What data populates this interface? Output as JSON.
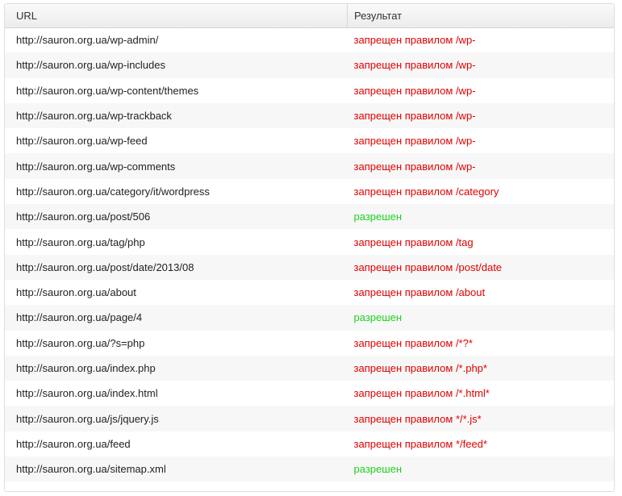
{
  "table": {
    "headers": {
      "url": "URL",
      "result": "Результат"
    },
    "colors": {
      "denied": "#e00000",
      "allowed": "#1ed21e"
    },
    "rows": [
      {
        "url": "http://sauron.org.ua/wp-admin/",
        "result": "запрещен правилом /wp-",
        "status": "denied"
      },
      {
        "url": "http://sauron.org.ua/wp-includes",
        "result": "запрещен правилом /wp-",
        "status": "denied"
      },
      {
        "url": "http://sauron.org.ua/wp-content/themes",
        "result": "запрещен правилом /wp-",
        "status": "denied"
      },
      {
        "url": "http://sauron.org.ua/wp-trackback",
        "result": "запрещен правилом /wp-",
        "status": "denied"
      },
      {
        "url": "http://sauron.org.ua/wp-feed",
        "result": "запрещен правилом /wp-",
        "status": "denied"
      },
      {
        "url": "http://sauron.org.ua/wp-comments",
        "result": "запрещен правилом /wp-",
        "status": "denied"
      },
      {
        "url": "http://sauron.org.ua/category/it/wordpress",
        "result": "запрещен правилом /category",
        "status": "denied"
      },
      {
        "url": "http://sauron.org.ua/post/506",
        "result": "разрешен",
        "status": "allowed"
      },
      {
        "url": "http://sauron.org.ua/tag/php",
        "result": "запрещен правилом /tag",
        "status": "denied"
      },
      {
        "url": "http://sauron.org.ua/post/date/2013/08",
        "result": "запрещен правилом /post/date",
        "status": "denied"
      },
      {
        "url": "http://sauron.org.ua/about",
        "result": "запрещен правилом /about",
        "status": "denied"
      },
      {
        "url": "http://sauron.org.ua/page/4",
        "result": "разрешен",
        "status": "allowed"
      },
      {
        "url": "http://sauron.org.ua/?s=php",
        "result": "запрещен правилом /*?*",
        "status": "denied"
      },
      {
        "url": "http://sauron.org.ua/index.php",
        "result": "запрещен правилом /*.php*",
        "status": "denied"
      },
      {
        "url": "http://sauron.org.ua/index.html",
        "result": "запрещен правилом /*.html*",
        "status": "denied"
      },
      {
        "url": "http://sauron.org.ua/js/jquery.js",
        "result": "запрещен правилом */*.js*",
        "status": "denied"
      },
      {
        "url": "http://sauron.org.ua/feed",
        "result": "запрещен правилом */feed*",
        "status": "denied"
      },
      {
        "url": "http://sauron.org.ua/sitemap.xml",
        "result": "разрешен",
        "status": "allowed"
      }
    ]
  }
}
